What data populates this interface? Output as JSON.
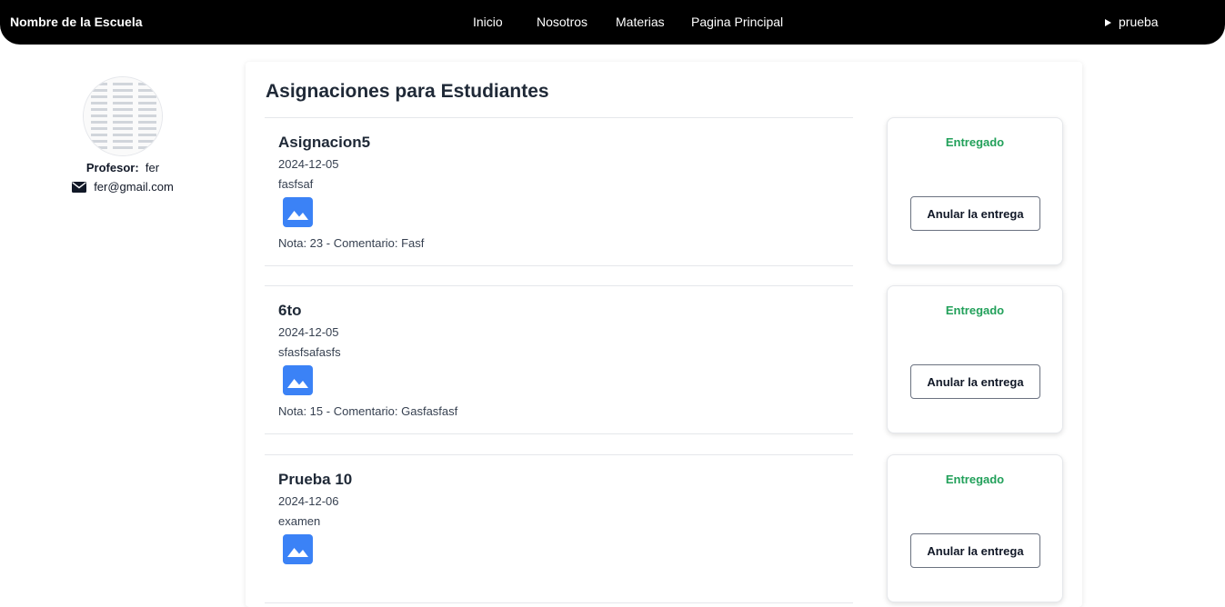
{
  "navbar": {
    "brand": "Nombre de la Escuela",
    "links": [
      "Inicio",
      "Nosotros",
      "Materias",
      "Pagina Principal"
    ],
    "user": "prueba"
  },
  "profile": {
    "label": "Profesor:",
    "name": "fer",
    "email": "fer@gmail.com"
  },
  "main": {
    "title": "Asignaciones para Estudiantes",
    "assignments": [
      {
        "title": "Asignacion5",
        "date": "2024-12-05",
        "description": "fasfsaf",
        "grade": "Nota: 23 - Comentario: Fasf",
        "status": "Entregado",
        "button": "Anular la entrega"
      },
      {
        "title": "6to",
        "date": "2024-12-05",
        "description": "sfasfsafasfs",
        "grade": "Nota: 15 - Comentario: Gasfasfasf",
        "status": "Entregado",
        "button": "Anular la entrega"
      },
      {
        "title": "Prueba 10",
        "date": "2024-12-06",
        "description": "examen",
        "grade": "",
        "status": "Entregado",
        "button": "Anular la entrega"
      }
    ]
  },
  "colors": {
    "navbar": "#000000",
    "status_green": "#22a05a",
    "image_icon": "#3b82f6"
  },
  "icons": {
    "caret": "caret-right-icon",
    "mail": "envelope-icon",
    "assignment_image": "image-icon"
  }
}
